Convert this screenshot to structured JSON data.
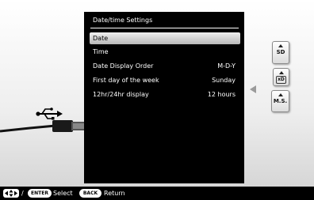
{
  "dialog": {
    "title": "Date/time Settings",
    "items": [
      {
        "label": "Date",
        "value": "",
        "selected": true
      },
      {
        "label": "Time",
        "value": ""
      },
      {
        "label": "Date Display Order",
        "value": "M-D-Y"
      },
      {
        "label": "First day of the week",
        "value": "Sunday"
      },
      {
        "label": "12hr/24hr display",
        "value": "12 hours"
      }
    ]
  },
  "cards": {
    "sd": "SD",
    "xd": "xD",
    "ms": "M.S."
  },
  "bottom_bar": {
    "slash": "/",
    "enter_key": "ENTER",
    "select_label": "Select",
    "back_key": "BACK",
    "return_label": "Return"
  },
  "icons": {
    "usb": "usb-icon",
    "dpad": "dpad-icon"
  }
}
